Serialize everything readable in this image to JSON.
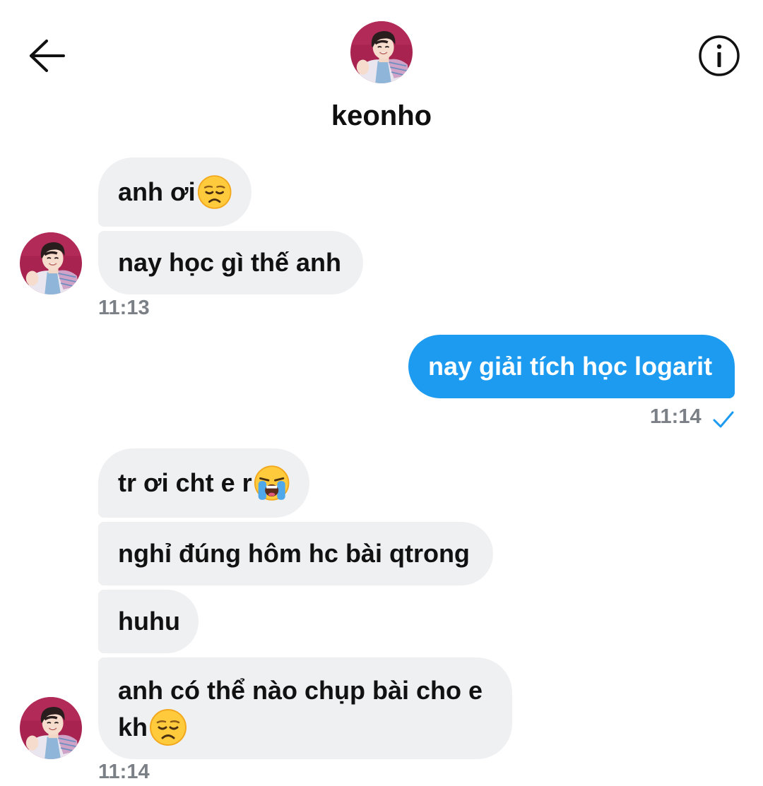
{
  "header": {
    "contact_name": "keonho",
    "back_icon": "arrow-left-icon",
    "info_icon": "info-circle-icon"
  },
  "messages": [
    {
      "direction": "incoming",
      "text": "anh ơi",
      "emoji": "disappointed-face"
    },
    {
      "direction": "incoming",
      "text": "nay học gì thế anh"
    },
    {
      "direction": "incoming",
      "timestamp": "11:13"
    },
    {
      "direction": "outgoing",
      "text": "nay giải tích học logarit",
      "timestamp": "11:14",
      "status": "sent-check-icon"
    },
    {
      "direction": "incoming",
      "text": "tr ơi cht e r",
      "emoji": "loudly-crying-face"
    },
    {
      "direction": "incoming",
      "text": "nghỉ đúng hôm hc bài qtrong"
    },
    {
      "direction": "incoming",
      "text": "huhu"
    },
    {
      "direction": "incoming",
      "text_line1": "anh có thể nào chụp bài cho e",
      "text_line2": "kh",
      "emoji": "disappointed-face",
      "timestamp": "11:14"
    }
  ],
  "colors": {
    "incoming_bubble": "#eff0f2",
    "outgoing_bubble": "#1d9bf0",
    "timestamp": "#7b8087",
    "check": "#1d9bf0"
  }
}
